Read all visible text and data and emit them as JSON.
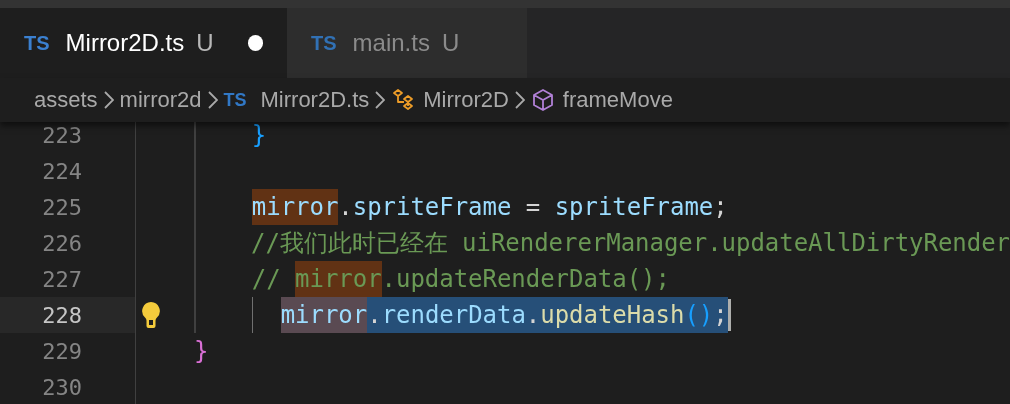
{
  "tabs": [
    {
      "badge": "TS",
      "label": "Mirror2D.ts",
      "git_status": "U",
      "selected": true,
      "dirty": true
    },
    {
      "badge": "TS",
      "label": "main.ts",
      "git_status": "U",
      "selected": false,
      "dirty": false
    }
  ],
  "breadcrumbs": [
    {
      "kind": "folder",
      "label": "assets"
    },
    {
      "kind": "folder",
      "label": "mirror2d"
    },
    {
      "kind": "file",
      "badge": "TS",
      "label": "Mirror2D.ts"
    },
    {
      "kind": "class",
      "label": "Mirror2D"
    },
    {
      "kind": "method",
      "label": "frameMove"
    }
  ],
  "editor": {
    "lines": [
      {
        "number": "223",
        "kind": "body",
        "current": false,
        "lightbulb": false,
        "cursor": false,
        "tokens": [
          {
            "kind": "brace-blue",
            "text": "}"
          }
        ]
      },
      {
        "number": "224",
        "kind": "blank",
        "current": false,
        "lightbulb": false,
        "cursor": false
      },
      {
        "number": "225",
        "kind": "body",
        "current": false,
        "lightbulb": false,
        "cursor": false,
        "tokens": [
          {
            "kind": "variable",
            "text": "mirror",
            "highlight": true
          },
          {
            "kind": "plain",
            "text": "."
          },
          {
            "kind": "variable",
            "text": "spriteFrame"
          },
          {
            "kind": "plain",
            "text": " = "
          },
          {
            "kind": "variable",
            "text": "spriteFrame"
          },
          {
            "kind": "plain",
            "text": ";"
          }
        ]
      },
      {
        "number": "226",
        "kind": "body",
        "current": false,
        "lightbulb": false,
        "cursor": false,
        "tokens": [
          {
            "kind": "comment",
            "text": "//我们此时已经在 uiRendererManager.updateAllDirtyRender"
          }
        ]
      },
      {
        "number": "227",
        "kind": "body",
        "current": false,
        "lightbulb": false,
        "cursor": false,
        "tokens": [
          {
            "kind": "comment",
            "text": "// "
          },
          {
            "kind": "comment",
            "text": "mirror",
            "highlight": true
          },
          {
            "kind": "comment",
            "text": ".updateRenderData();"
          }
        ]
      },
      {
        "number": "228",
        "kind": "continuation",
        "current": true,
        "lightbulb": true,
        "cursor": true,
        "tokens": [
          {
            "kind": "variable",
            "text": "mirror",
            "highlight": true,
            "in_selection": true
          },
          {
            "kind": "plain",
            "text": ".",
            "in_selection": true
          },
          {
            "kind": "variable",
            "text": "renderData",
            "in_selection": true
          },
          {
            "kind": "plain",
            "text": ".",
            "in_selection": true
          },
          {
            "kind": "function",
            "text": "updateHash",
            "in_selection": true
          },
          {
            "kind": "brace-blue",
            "text": "()",
            "in_selection": true
          },
          {
            "kind": "plain",
            "text": ";",
            "in_selection": true
          }
        ]
      },
      {
        "number": "229",
        "kind": "top",
        "current": false,
        "lightbulb": false,
        "cursor": false,
        "tokens": [
          {
            "kind": "brace-pink",
            "text": "}"
          }
        ]
      },
      {
        "number": "230",
        "kind": "end",
        "current": false,
        "lightbulb": false,
        "cursor": false
      }
    ]
  }
}
